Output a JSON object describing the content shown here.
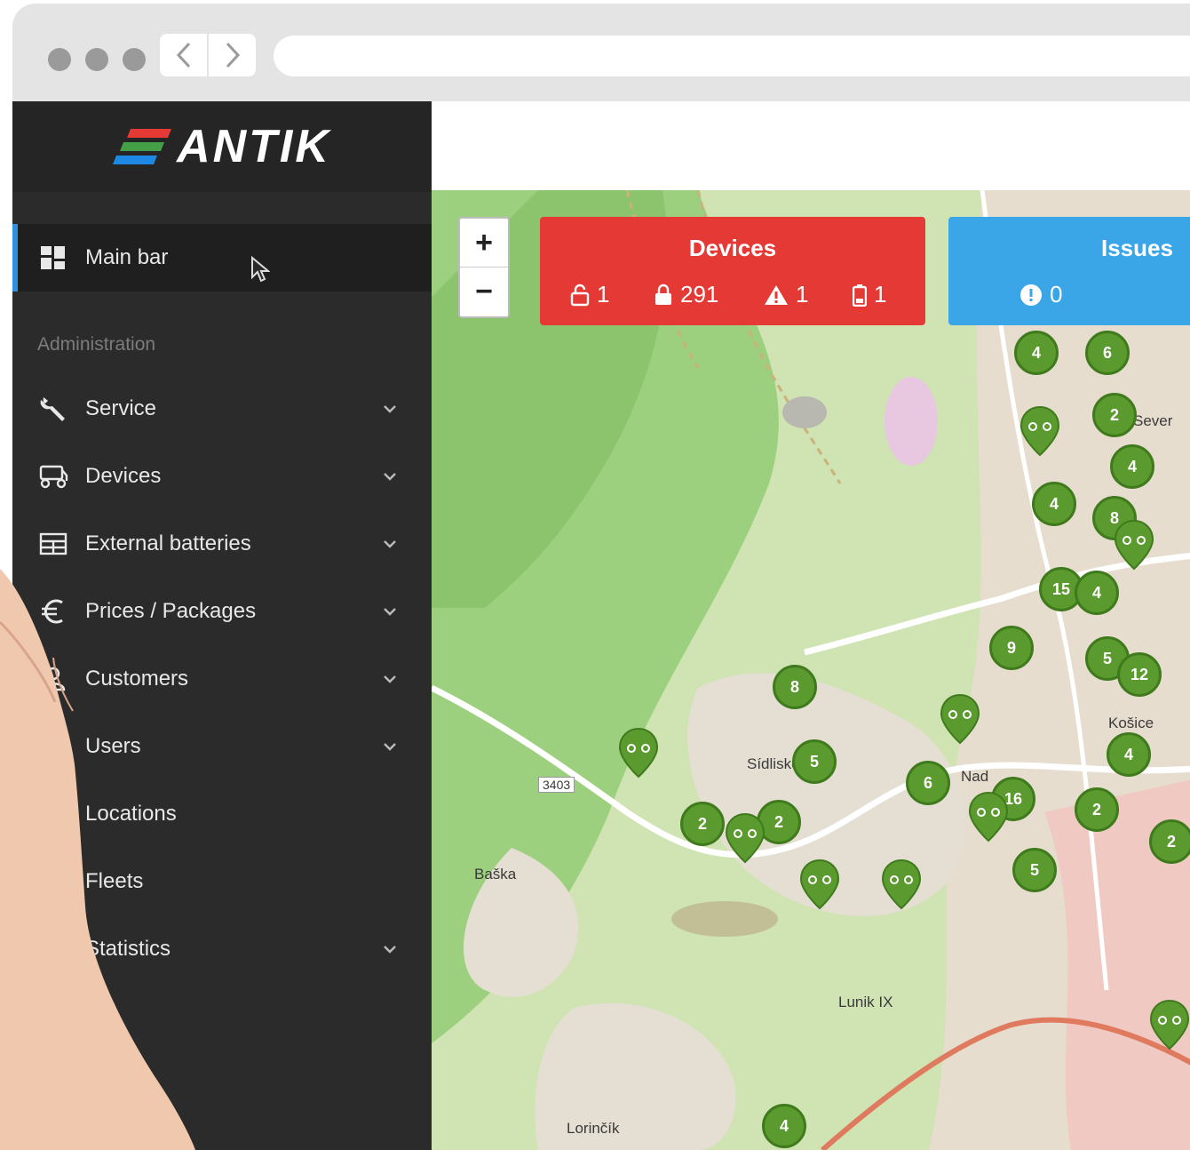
{
  "brand": {
    "logo_text": "ANTIK",
    "logo_colors": [
      "#e53935",
      "#43a047",
      "#1e88e5"
    ]
  },
  "sidebar": {
    "active_item": {
      "label": "Main bar",
      "icon": "dashboard-icon"
    },
    "section_label": "Administration",
    "items": [
      {
        "label": "Service",
        "icon": "wrench-icon",
        "has_submenu": true
      },
      {
        "label": "Devices",
        "icon": "scooter-icon",
        "has_submenu": true
      },
      {
        "label": "External batteries",
        "icon": "battery-pack-icon",
        "has_submenu": true
      },
      {
        "label": "Prices / Packages",
        "icon": "euro-icon",
        "has_submenu": true
      },
      {
        "label": "Customers",
        "icon": "customers-icon",
        "has_submenu": true
      },
      {
        "label": "Users",
        "icon": "user-icon",
        "has_submenu": true
      },
      {
        "label": "Locations",
        "icon": "location-icon",
        "has_submenu": false
      },
      {
        "label": "Fleets",
        "icon": "fleet-icon",
        "has_submenu": false
      },
      {
        "label": "Statistics",
        "icon": "chart-icon",
        "has_submenu": true
      }
    ]
  },
  "map": {
    "zoom_in": "+",
    "zoom_out": "−",
    "devices_card": {
      "title": "Devices",
      "color": "#e53935",
      "stats": [
        {
          "icon": "unlocked-icon",
          "value": "1"
        },
        {
          "icon": "locked-icon",
          "value": "291"
        },
        {
          "icon": "warning-icon",
          "value": "1"
        },
        {
          "icon": "battery-low-icon",
          "value": "1"
        }
      ]
    },
    "issues_card": {
      "title": "Issues",
      "color": "#3aa6e8",
      "stats": [
        {
          "icon": "alert-icon",
          "value": "0"
        }
      ]
    },
    "cluster_color": "#5b9a2e",
    "clusters": [
      "4",
      "6",
      "2",
      "4",
      "4",
      "8",
      "15",
      "4",
      "9",
      "5",
      "12",
      "8",
      "5",
      "6",
      "16",
      "4",
      "2",
      "2",
      "2",
      "5",
      "2",
      "4"
    ],
    "places": [
      "Sídlisko KVP",
      "Baška",
      "Lunik IX",
      "Košice",
      "Lorinčík",
      "3403",
      "Sever",
      "Nad"
    ]
  }
}
